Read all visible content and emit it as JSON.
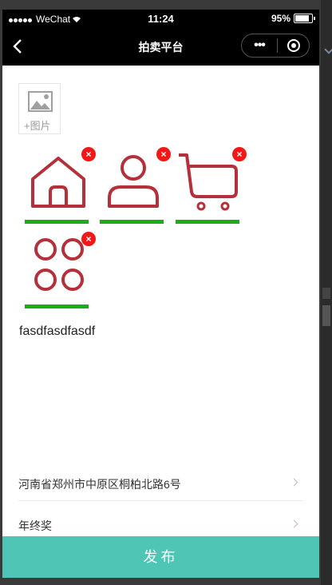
{
  "statusbar": {
    "carrier": "WeChat",
    "time": "11:24",
    "battery": "95%"
  },
  "navbar": {
    "title": "拍卖平台",
    "more": "•••"
  },
  "upload": {
    "label": "+图片"
  },
  "thumbnails": [
    {
      "icon": "home-icon"
    },
    {
      "icon": "user-icon"
    },
    {
      "icon": "cart-icon"
    },
    {
      "icon": "apps-icon"
    }
  ],
  "delete_symbol": "×",
  "description": "fasdfasdfasdf",
  "address": "河南省郑州市中原区桐柏北路6号",
  "prize": "年终奖",
  "publish_label": "发布",
  "colors": {
    "accent": "#4ec5b5",
    "icon": "#b5303a",
    "underline": "#1aad19",
    "delete": "#f21818"
  }
}
